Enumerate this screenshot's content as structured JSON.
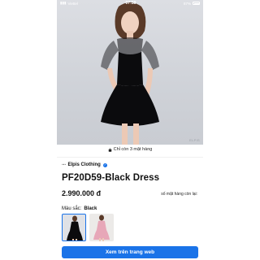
{
  "status_bar": {
    "carrier": "Viettel",
    "time": "07:58",
    "battery": "87%"
  },
  "photo": {
    "watermark": "ELPIS"
  },
  "stock_note": "Chỉ còn 3 mặt hàng",
  "brand": {
    "logo_text": "⋯",
    "name": "Elpis Clothing"
  },
  "product": {
    "title": "PF20D59-Black Dress",
    "price": "2.990.000 đ",
    "qty_label": "số mặt hàng còn lại:"
  },
  "color": {
    "label": "Màu sắc:",
    "selected": "Black",
    "options": [
      "Black",
      "Pink"
    ]
  },
  "cta": {
    "label": "Xem trên trang web"
  },
  "colors": {
    "accent": "#1a73e8",
    "dress": "#0b0b0d"
  }
}
